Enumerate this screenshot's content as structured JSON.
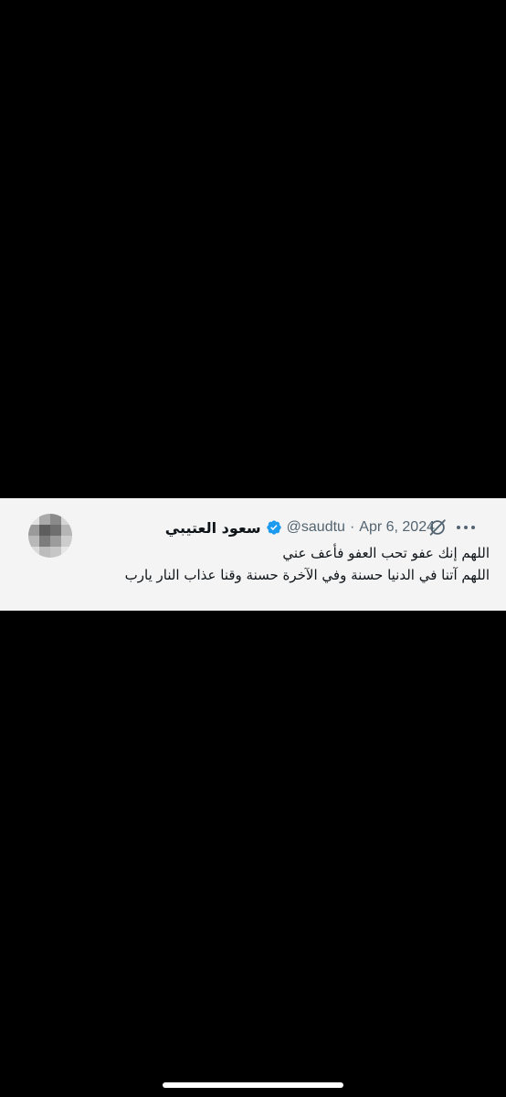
{
  "tweet": {
    "display_name": "سعود العتيبي",
    "handle": "@saudtu",
    "separator": "·",
    "date": "Apr 6, 2024",
    "text_lines": [
      "اللهم إنك عفو تحب العفو فأعف عني",
      "اللهم آتنا في الدنيا حسنة وفي الآخرة حسنة وقنا عذاب النار يارب"
    ],
    "icons": {
      "verified": "verified-badge-icon",
      "grok": "grok-icon",
      "more": "more-options-icon"
    },
    "colors": {
      "card_background": "#f4f4f4",
      "name": "#0f1419",
      "meta": "#536471",
      "verified": "#1d9bf0"
    }
  },
  "screen": {
    "background": "#000000"
  }
}
